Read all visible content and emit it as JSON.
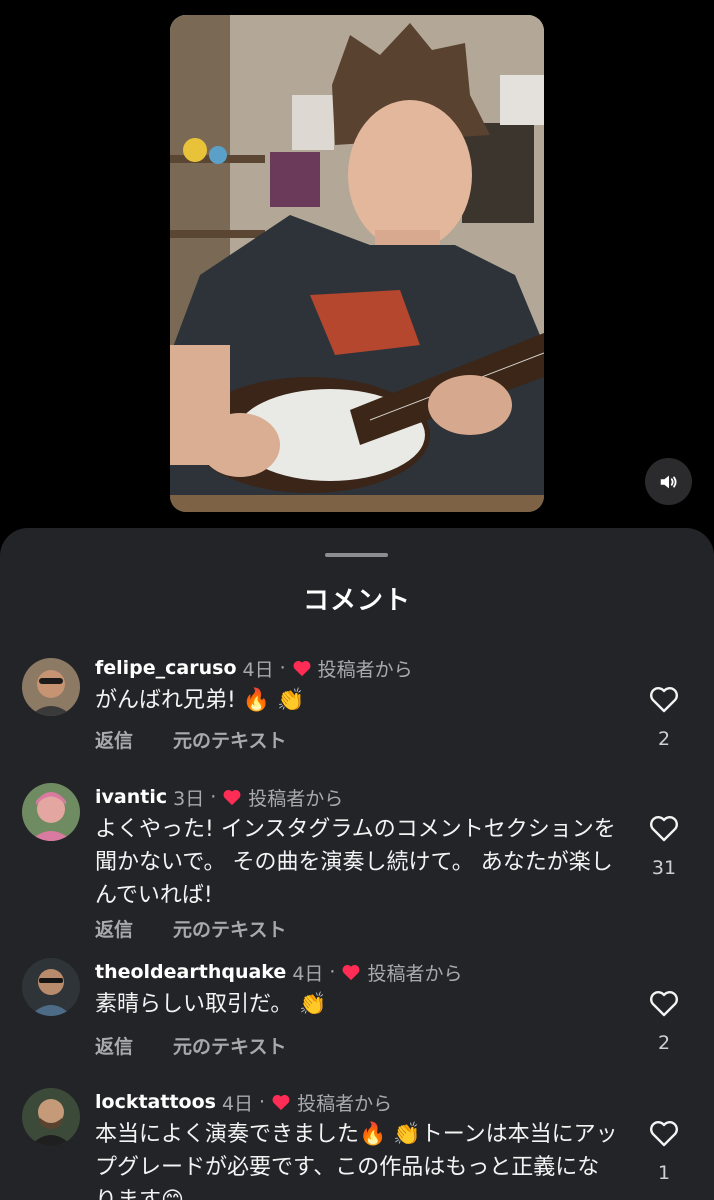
{
  "sheet": {
    "title": "コメント"
  },
  "common": {
    "reply_label": "返信",
    "original_text_label": "元のテキスト",
    "by_author_label": "投稿者から",
    "dot": "·"
  },
  "comments": [
    {
      "username": "felipe_caruso",
      "time": "4日",
      "text": "がんばれ兄弟! 🔥 👏",
      "likes": "2"
    },
    {
      "username": "ivantic",
      "time": "3日",
      "text": "よくやった! インスタグラムのコメントセクションを聞かないで。 その曲を演奏し続けて。 あなたが楽しんでいれば!",
      "likes": "31"
    },
    {
      "username": "theoldearthquake",
      "time": "4日",
      "text": "素晴らしい取引だ。 👏",
      "likes": "2"
    },
    {
      "username": "locktattoos",
      "time": "4日",
      "text": "本当によく演奏できました🔥 👏トーンは本当にアップグレードが必要です、この作品はもっと正義になります😊",
      "likes": "1"
    }
  ],
  "colors": {
    "sheet_bg": "#232427",
    "heart_red": "#ff2d55",
    "secondary_text": "#a8a9ad"
  },
  "icons": {
    "sound": "speaker-icon",
    "like": "heart-outline-icon",
    "creator_liked": "heart-filled-icon"
  }
}
